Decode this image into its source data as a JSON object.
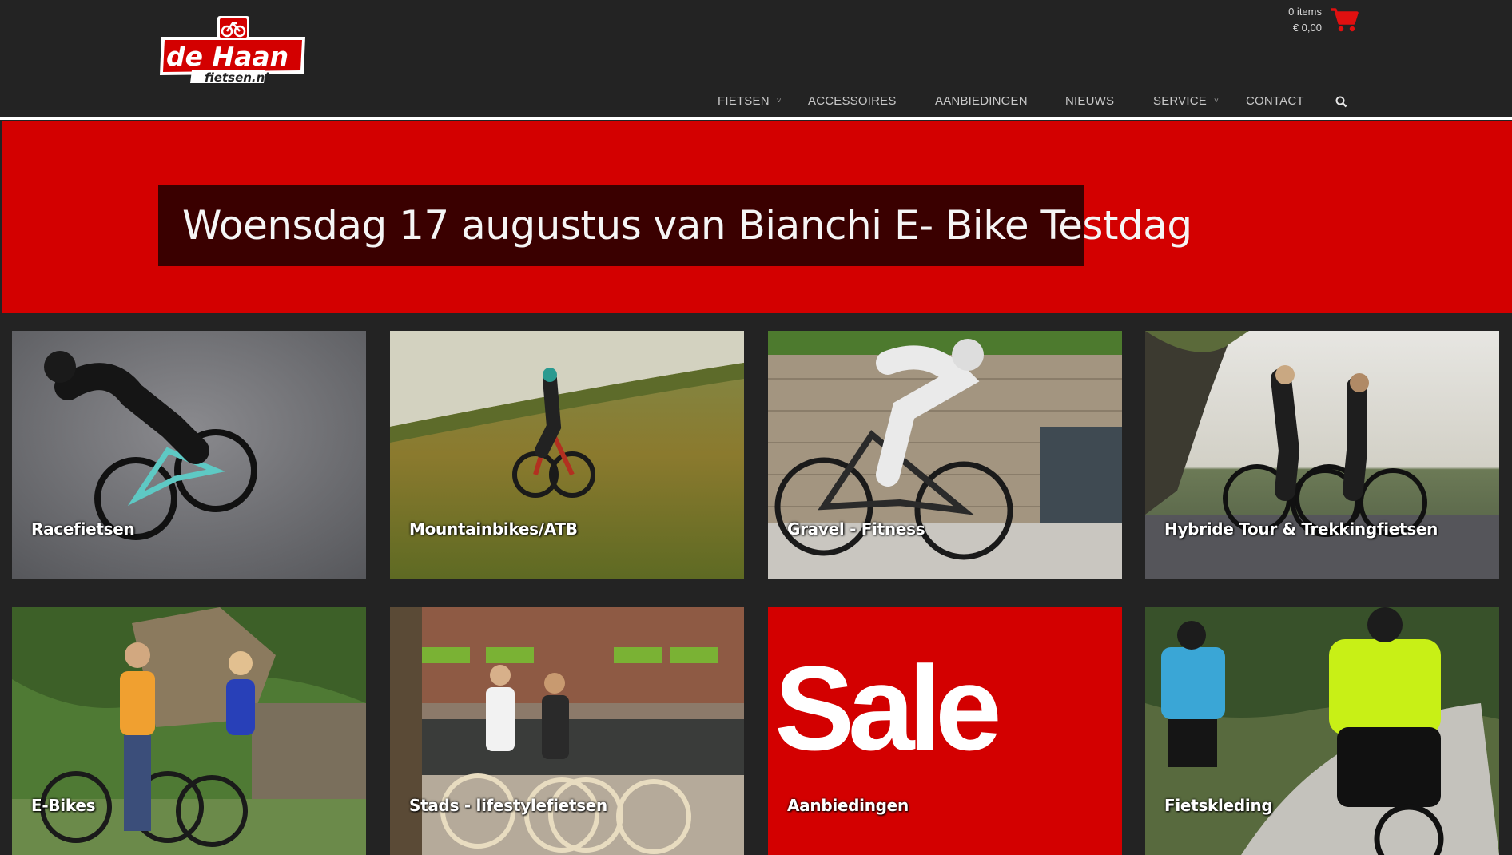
{
  "brand": {
    "logo_name": "de Haan",
    "logo_domain": "fietsen.nl"
  },
  "cart": {
    "items": "0 items",
    "total": "€ 0,00",
    "icon": "cart-icon"
  },
  "nav": {
    "items": [
      {
        "label": "FIETSEN",
        "dropdown": true
      },
      {
        "label": "ACCESSOIRES",
        "dropdown": false
      },
      {
        "label": "AANBIEDINGEN",
        "dropdown": false
      },
      {
        "label": "NIEUWS",
        "dropdown": false
      },
      {
        "label": "SERVICE",
        "dropdown": true
      },
      {
        "label": "CONTACT",
        "dropdown": false
      }
    ],
    "caret": "˅",
    "search_icon": "search-icon"
  },
  "hero": {
    "title": "Woensdag 17 augustus van Bianchi E- Bike Testdag",
    "background": "#d30000"
  },
  "categories": [
    {
      "label": "Racefietsen"
    },
    {
      "label": "Mountainbikes/ATB"
    },
    {
      "label": "Gravel - Fitness"
    },
    {
      "label": "Hybride Tour & Trekkingfietsen"
    },
    {
      "label": "E-Bikes"
    },
    {
      "label": "Stads - lifestylefietsen"
    },
    {
      "label": "Aanbiedingen",
      "image_text": "Sale"
    },
    {
      "label": "Fietskleding"
    }
  ],
  "colors": {
    "header_bg": "#232323",
    "accent_red": "#d30000",
    "hero_box": "#3a0000"
  }
}
